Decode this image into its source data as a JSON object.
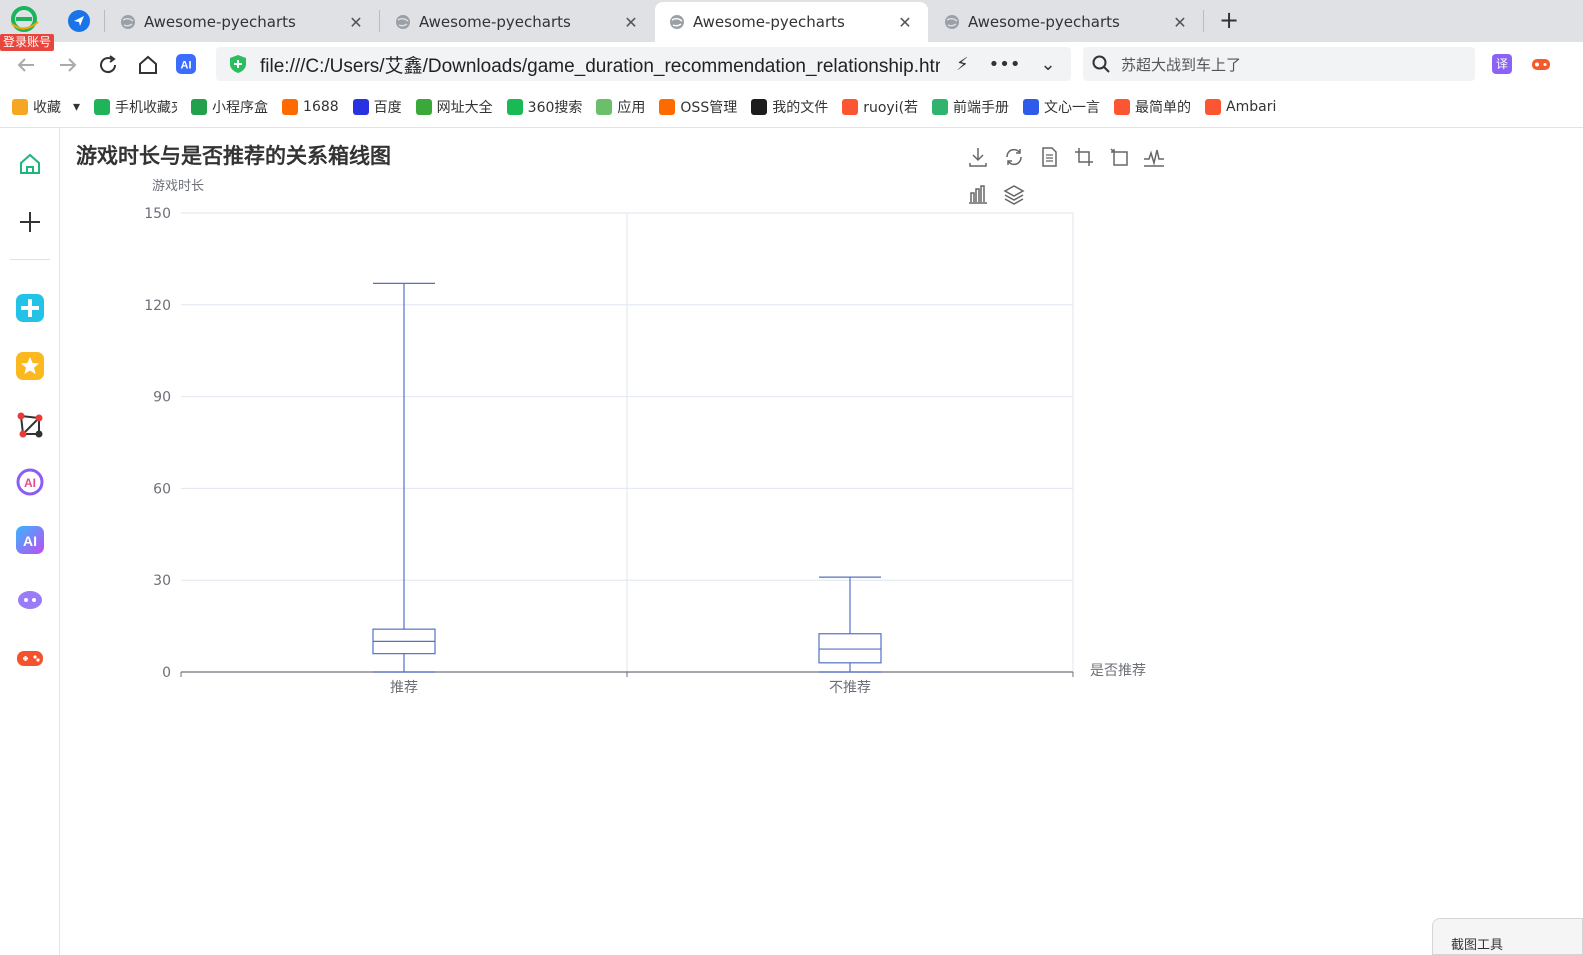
{
  "browser": {
    "login_badge": "登录账号",
    "tabs": [
      {
        "title": "Awesome-pyecharts",
        "active": false
      },
      {
        "title": "Awesome-pyecharts",
        "active": false
      },
      {
        "title": "Awesome-pyecharts",
        "active": true
      },
      {
        "title": "Awesome-pyecharts",
        "active": false
      }
    ],
    "url": "file:///C:/Users/艾鑫/Downloads/game_duration_recommendation_relationship.html",
    "search_placeholder": "苏超大战到车上了",
    "translate_label": "译",
    "ai_label": "AI",
    "bookmarks": [
      {
        "label": "收藏",
        "icon": "star-icon",
        "color": "#f5a623"
      },
      {
        "label": "手机收藏夹",
        "icon": "phone-icon",
        "color": "#21b35a"
      },
      {
        "label": "小程序盒",
        "icon": "miniapp-icon",
        "color": "#22a04b"
      },
      {
        "label": "1688",
        "icon": "1688-icon",
        "color": "#ff6a00"
      },
      {
        "label": "百度",
        "icon": "baidu-paw-icon",
        "color": "#2932e1"
      },
      {
        "label": "网址大全",
        "icon": "plus-circle-icon",
        "color": "#3aa93a"
      },
      {
        "label": "360搜索",
        "icon": "360-icon",
        "color": "#19b955"
      },
      {
        "label": "应用",
        "icon": "apps-icon",
        "color": "#6bbf6b"
      },
      {
        "label": "OSS管理",
        "icon": "oss-icon",
        "color": "#ff6a00"
      },
      {
        "label": "我的文件",
        "icon": "drop-icon",
        "color": "#1c1c1c"
      },
      {
        "label": "ruoyi(若",
        "icon": "csdn-icon",
        "color": "#fc5531"
      },
      {
        "label": "前端手册",
        "icon": "leaf-icon",
        "color": "#2fb36f"
      },
      {
        "label": "文心一言",
        "icon": "wenxin-icon",
        "color": "#2f5bea"
      },
      {
        "label": "最简单的",
        "icon": "csdn-icon",
        "color": "#fc5531"
      },
      {
        "label": "Ambari",
        "icon": "csdn-icon",
        "color": "#fc5531"
      }
    ],
    "snip_tool": "截图工具"
  },
  "chart_data": {
    "type": "boxplot",
    "title": "游戏时长与是否推荐的关系箱线图",
    "xlabel": "是否推荐",
    "ylabel": "游戏时长",
    "categories": [
      "推荐",
      "不推荐"
    ],
    "boxes": [
      {
        "category": "推荐",
        "min": 0,
        "q1": 6,
        "median": 10,
        "q3": 14,
        "max": 127
      },
      {
        "category": "不推荐",
        "min": 0,
        "q1": 3,
        "median": 7.5,
        "q3": 12.5,
        "max": 31
      }
    ],
    "ylim": [
      0,
      150
    ],
    "yticks": [
      0,
      30,
      60,
      90,
      120,
      150
    ],
    "grid": true,
    "color": "#5470c6"
  }
}
